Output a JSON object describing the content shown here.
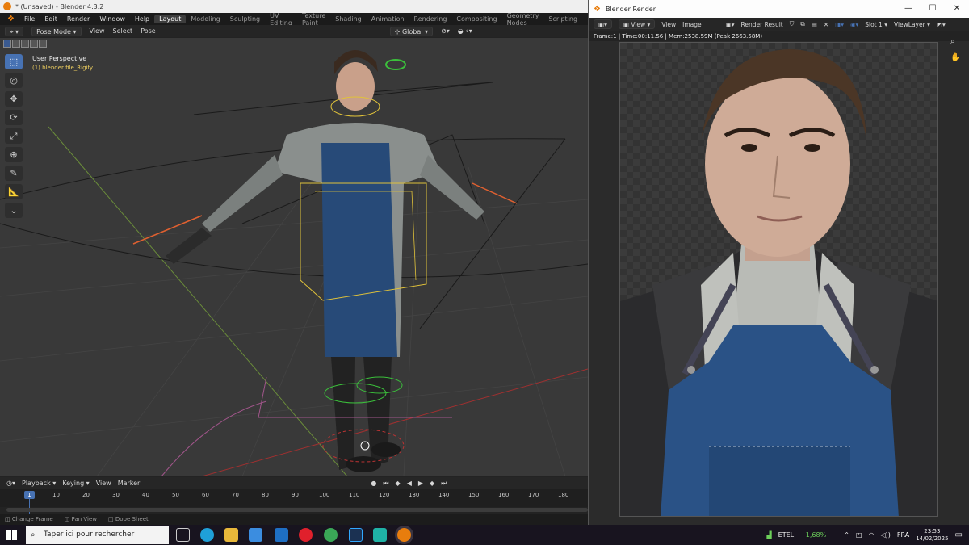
{
  "main_window": {
    "title": "* (Unsaved) - Blender 4.3.2",
    "menu": [
      "File",
      "Edit",
      "Render",
      "Window",
      "Help"
    ],
    "workspaces": [
      "Layout",
      "Modeling",
      "Sculpting",
      "UV Editing",
      "Texture Paint",
      "Shading",
      "Animation",
      "Rendering",
      "Compositing",
      "Geometry Nodes",
      "Scripting"
    ],
    "active_workspace": "Layout",
    "add_workspace": "+"
  },
  "viewport_header": {
    "mode": "Pose Mode",
    "menus": [
      "View",
      "Select",
      "Pose"
    ],
    "orientation": "Global"
  },
  "viewport": {
    "perspective_label": "User Perspective",
    "object_label": "(1) blender file_Rigify"
  },
  "tools": [
    {
      "name": "select-box-icon",
      "glyph": "⬚"
    },
    {
      "name": "cursor-icon",
      "glyph": "◎"
    },
    {
      "name": "move-icon",
      "glyph": "✥"
    },
    {
      "name": "rotate-icon",
      "glyph": "⟳"
    },
    {
      "name": "scale-icon",
      "glyph": "⤢"
    },
    {
      "name": "transform-icon",
      "glyph": "⊕"
    },
    {
      "name": "annotate-icon",
      "glyph": "✎"
    },
    {
      "name": "measure-icon",
      "glyph": "📐"
    },
    {
      "name": "bone-relax-icon",
      "glyph": "⌄"
    }
  ],
  "timeline": {
    "menus": [
      "Playback",
      "Keying",
      "View",
      "Marker"
    ],
    "current_frame": "1",
    "ticks": [
      "10",
      "20",
      "30",
      "40",
      "50",
      "60",
      "70",
      "80",
      "90",
      "100",
      "110",
      "120",
      "130",
      "140",
      "150",
      "160",
      "170",
      "180"
    ]
  },
  "statusbar": [
    "Change Frame",
    "Pan View",
    "Dope Sheet"
  ],
  "render_window": {
    "title": "Blender Render",
    "menus": [
      "View",
      "View",
      "Image"
    ],
    "image_name": "Render Result",
    "slot": "Slot 1",
    "view_layer": "ViewLayer",
    "info": "Frame:1 | Time:00:11.56 | Mem:2538.59M (Peak 2663.58M)",
    "win_buttons": [
      "—",
      "☐",
      "✕"
    ]
  },
  "taskbar": {
    "search_placeholder": "Taper ici pour rechercher",
    "stock_name": "ETEL",
    "stock_change": "+1,68%",
    "language": "FRA",
    "time": "23:53",
    "date": "14/02/2025"
  },
  "colors": {
    "accent": "#4772b3",
    "blender_orange": "#e87d0d",
    "selection_yellow": "#f0d060",
    "stock_green": "#6ccf5a"
  }
}
